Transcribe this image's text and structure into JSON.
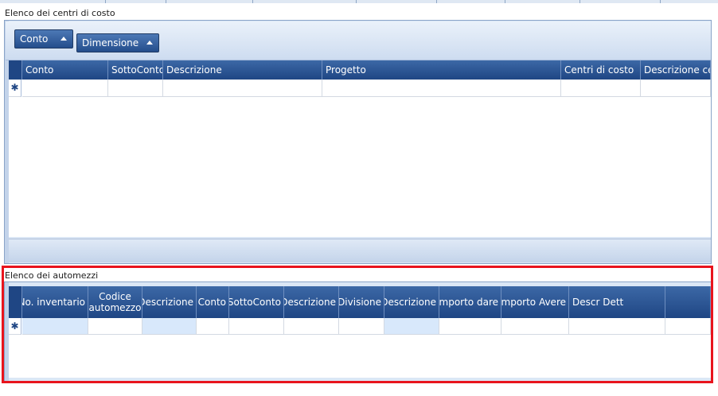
{
  "sections": {
    "top_title": "Elenco dei centri di costo",
    "bottom_title": "Elenco dei automezzi"
  },
  "group_buttons": [
    "Conto",
    "Dimensione"
  ],
  "grid1": {
    "columns": [
      "Conto",
      "SottoConto",
      "Descrizione",
      "Progetto",
      "Centri di costo",
      "Descrizione cen"
    ],
    "new_row_marker": "✱"
  },
  "grid2": {
    "columns": [
      "No. inventario",
      "Codice automezzo",
      "Descrizione",
      "Conto",
      "SottoConto",
      "Descrizione",
      "Divisione",
      "Descrizione",
      "Importo dare",
      "Importo Avere",
      "Descr Dett",
      ""
    ],
    "new_row_marker": "✱"
  },
  "colors": {
    "header_blue": "#2a5596",
    "panel_bg": "#dbe7f5",
    "highlight_red": "#e8141d"
  }
}
